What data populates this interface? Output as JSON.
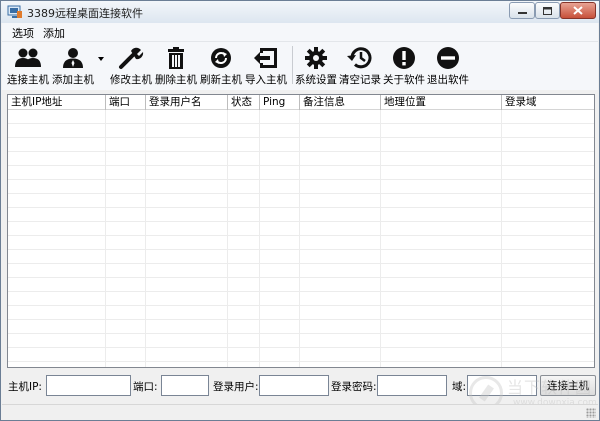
{
  "window": {
    "title": "3389远程桌面连接软件"
  },
  "menu": {
    "items": [
      "选项",
      "添加"
    ]
  },
  "toolbar": {
    "buttons": [
      {
        "label": "连接主机",
        "icon": "users-icon"
      },
      {
        "label": "添加主机",
        "icon": "add-user-icon"
      },
      {
        "label": "修改主机",
        "icon": "wrench-icon"
      },
      {
        "label": "删除主机",
        "icon": "trash-icon"
      },
      {
        "label": "刷新主机",
        "icon": "refresh-icon"
      },
      {
        "label": "导入主机",
        "icon": "import-icon"
      },
      {
        "label": "系统设置",
        "icon": "gear-icon"
      },
      {
        "label": "清空记录",
        "icon": "history-icon"
      },
      {
        "label": "关于软件",
        "icon": "info-icon"
      },
      {
        "label": "退出软件",
        "icon": "exit-icon"
      }
    ]
  },
  "table": {
    "columns": [
      "主机IP地址",
      "端口",
      "登录用户名",
      "状态",
      "Ping",
      "备注信息",
      "地理位置",
      "登录域"
    ],
    "rows": []
  },
  "form": {
    "host_ip_label": "主机IP:",
    "host_ip_value": "",
    "port_label": "端口:",
    "port_value": "",
    "user_label": "登录用户:",
    "user_value": "",
    "password_label": "登录密码:",
    "password_value": "",
    "domain_label": "域:",
    "domain_value": "",
    "connect_button": "连接主机"
  },
  "watermark": {
    "text_cn": "当下软件园",
    "text_en": "www.downxia.com"
  }
}
